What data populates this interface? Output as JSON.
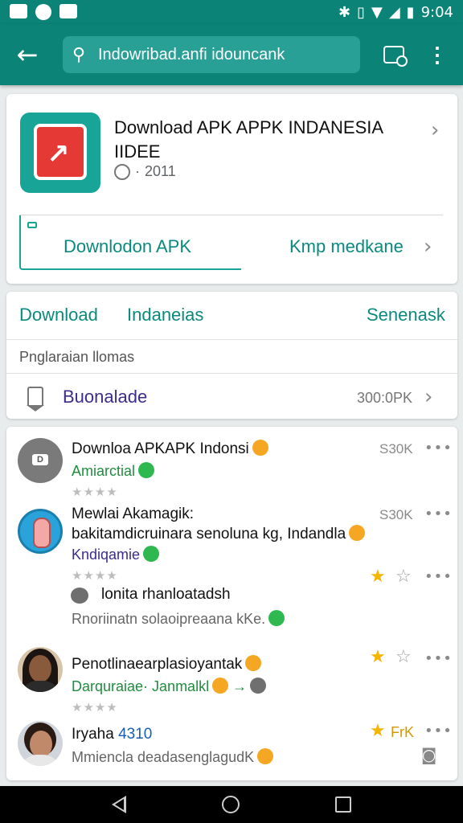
{
  "status_bar": {
    "time": "9:04"
  },
  "app_bar": {
    "search_text": "Indowribad.anfi idouncank"
  },
  "app_card": {
    "title_line1": "Download APK APPK INDANESIA",
    "title_line2": "IIDEE",
    "year": "2011",
    "download_button": "Downlodon APK",
    "secondary_link": "Kmp medkane"
  },
  "tabs_card": {
    "tabs": [
      "Download",
      "Indaneias",
      "Senenask"
    ],
    "section_label": "Pnglaraian llomas",
    "row_label": "Buonalade",
    "row_value": "300:0PK"
  },
  "list": [
    {
      "title": "Downloa APKAPK Indonsi",
      "subtitle": "Amiarctial",
      "count": "S30K"
    },
    {
      "title": "Mewlai Akamagik:",
      "title2": "bakitamdicruinara senoluna kg, Indandla",
      "subtitle": "Kndiqamie",
      "count": "S30K",
      "detail_title": "lonita rhanloatadsh",
      "detail_sub": "Rnoriinatn solaoipreaana kKe."
    },
    {
      "title": "Penotlinaearplasioyantak",
      "subtitle": "Darquraiae· Janmalkl",
      "arrow": "→"
    },
    {
      "title": "Iryaha",
      "title_num": "4310",
      "subtitle": "Mmiencla deadasenglagudK",
      "rating_label": "FrK"
    }
  ]
}
